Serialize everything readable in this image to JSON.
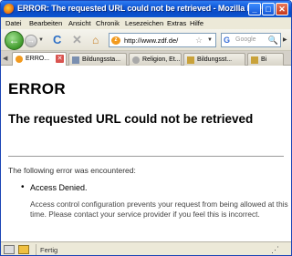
{
  "window": {
    "title": "ERROR: The requested URL could not be retrieved - Mozilla Firefox",
    "controls": {
      "minimize": "_",
      "maximize": "□",
      "close": "✕"
    }
  },
  "menu": [
    "Datei",
    "Bearbeiten",
    "Ansicht",
    "Chronik",
    "Lesezeichen",
    "Extras",
    "Hilfe"
  ],
  "nav": {
    "url": "http://www.zdf.de/",
    "search_placeholder": "Google",
    "icons": {
      "back": "←",
      "forward": "→",
      "reload": "C",
      "stop": "✕",
      "home": "⌂",
      "star": "☆",
      "search": "🔍"
    }
  },
  "tabs": [
    {
      "label": "ERRO...",
      "active": true
    },
    {
      "label": "Bildungssta...",
      "active": false
    },
    {
      "label": "Religion, Et...",
      "active": false
    },
    {
      "label": "Bildungsst...",
      "active": false
    },
    {
      "label": "Bi",
      "active": false
    }
  ],
  "page": {
    "h1": "ERROR",
    "h2": "The requested URL could not be retrieved",
    "intro": "The following error was encountered:",
    "error_item": "Access Denied.",
    "explanation": "Access control configuration prevents your request from being allowed at this time. Please contact your service provider if you feel this is incorrect."
  },
  "status": {
    "text": "Fertig"
  },
  "colors": {
    "titlebar": "#0a4bc6",
    "chrome": "#ece9d8",
    "back_button": "#3f9a2b"
  }
}
